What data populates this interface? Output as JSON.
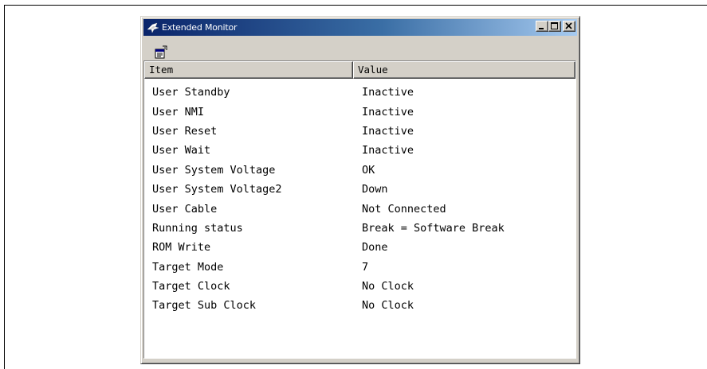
{
  "window": {
    "title": "Extended Monitor",
    "buttons": [
      "minimize",
      "maximize",
      "close"
    ]
  },
  "toolbar": {
    "icons": [
      "properties-icon"
    ]
  },
  "list": {
    "columns": [
      "Item",
      "Value"
    ],
    "rows": [
      {
        "item": "User Standby",
        "value": "Inactive"
      },
      {
        "item": "User NMI",
        "value": "Inactive"
      },
      {
        "item": "User Reset",
        "value": "Inactive"
      },
      {
        "item": "User Wait",
        "value": "Inactive"
      },
      {
        "item": "User System Voltage",
        "value": "OK"
      },
      {
        "item": "User System Voltage2",
        "value": "Down"
      },
      {
        "item": "User Cable",
        "value": "Not Connected"
      },
      {
        "item": "Running status",
        "value": "Break = Software Break"
      },
      {
        "item": "ROM Write",
        "value": "Done"
      },
      {
        "item": "Target Mode",
        "value": "7"
      },
      {
        "item": "Target Clock",
        "value": "No Clock"
      },
      {
        "item": "Target Sub Clock",
        "value": "No Clock"
      }
    ]
  },
  "colors": {
    "title_start": "#0a246a",
    "title_end": "#a6caf0",
    "face": "#d4d0c8"
  }
}
